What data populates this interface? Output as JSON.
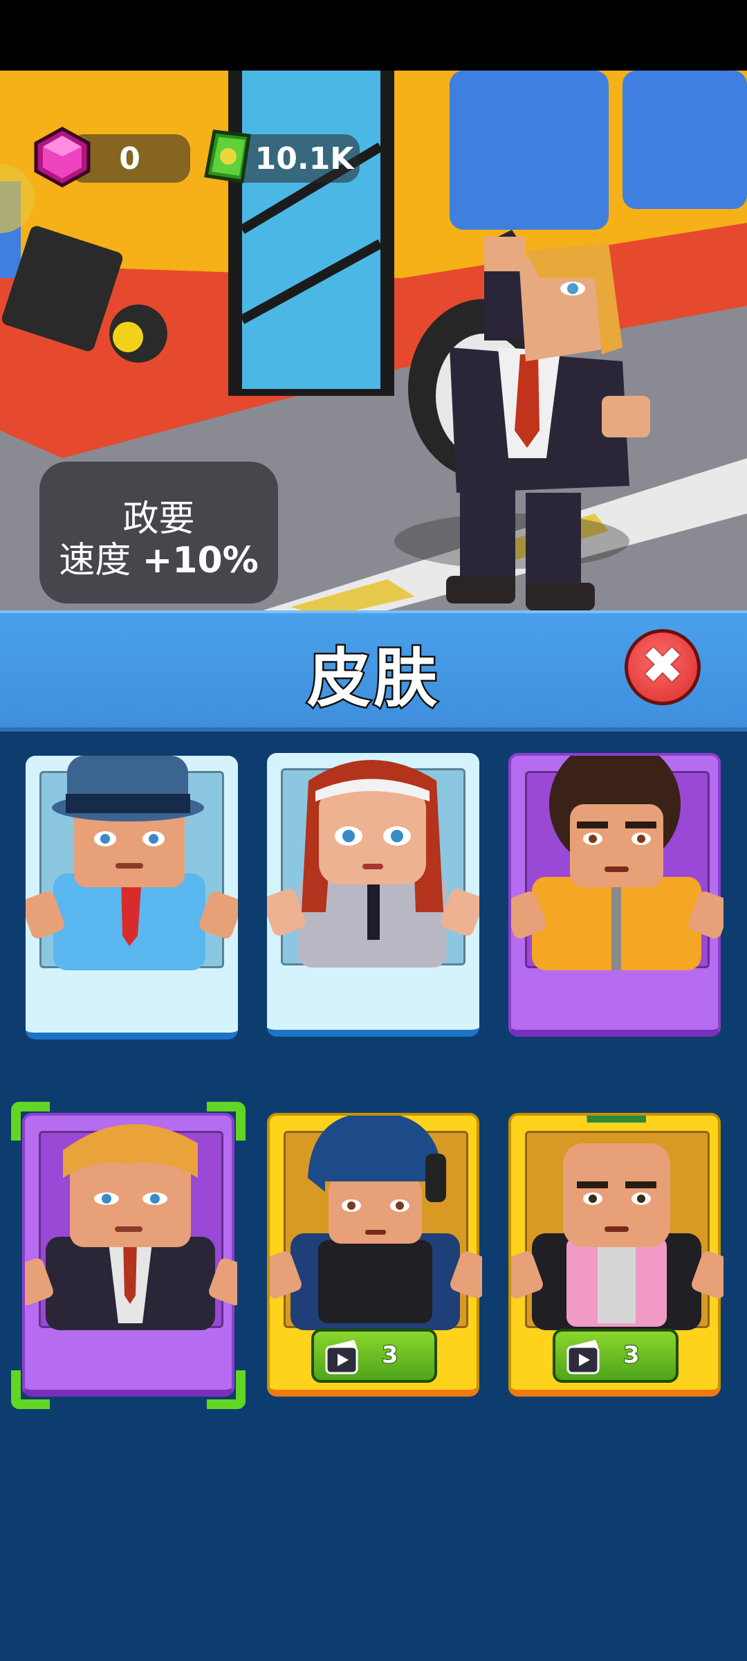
{
  "hud": {
    "gems": "0",
    "cash": "10.1K",
    "gem_icon": "pink-gem-icon",
    "cash_icon": "cash-stack-icon"
  },
  "perk": {
    "name": "政要",
    "label": "速度",
    "bonus": "+10%"
  },
  "header": {
    "title": "皮肤",
    "close_icon": "close-x-icon"
  },
  "skins": [
    {
      "id": "police-officer",
      "rarity": "common",
      "color": "#d4f3fc"
    },
    {
      "id": "security-guard",
      "rarity": "common",
      "color": "#d4f3fc"
    },
    {
      "id": "afro-fighter",
      "rarity": "epic",
      "color": "#b66cf0"
    },
    {
      "id": "politician",
      "rarity": "epic",
      "color": "#b66cf0",
      "selected": true
    },
    {
      "id": "swat-soldier",
      "rarity": "legendary",
      "color": "#ffd21c",
      "ad_count": "3",
      "ad_icon": "video-clapper-icon"
    },
    {
      "id": "punk",
      "rarity": "legendary",
      "color": "#ffd21c",
      "ad_count": "3",
      "ad_icon": "video-clapper-icon"
    }
  ],
  "colors": {
    "background": "#0d3d6e",
    "header": "#4aa0ea",
    "selection": "#61d624"
  }
}
